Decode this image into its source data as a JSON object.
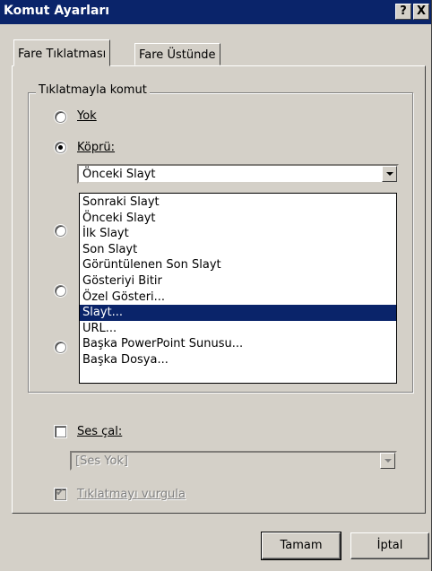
{
  "window": {
    "title": "Komut Ayarları",
    "help_label": "?",
    "close_label": "X"
  },
  "tabs": [
    {
      "label": "Fare Tıklatması",
      "active": true
    },
    {
      "label": "Fare Üstünde",
      "active": false
    }
  ],
  "group": {
    "legend": "Tıklatmayla komut"
  },
  "options": {
    "none_label": "Yok",
    "hyperlink_label": "Köprü:",
    "selected_option": "Köprü:"
  },
  "hyperlink_combo": {
    "value": "Önceki Slayt"
  },
  "dropdown": {
    "items": [
      "Sonraki Slayt",
      "Önceki Slayt",
      "İlk Slayt",
      "Son Slayt",
      "Görüntülenen Son Slayt",
      "Gösteriyi Bitir",
      "Özel Gösteri...",
      "Slayt...",
      "URL...",
      "Başka PowerPoint Sunusu...",
      "Başka Dosya..."
    ],
    "highlighted": "Slayt..."
  },
  "sound": {
    "label": "Ses çal:",
    "checked": false,
    "combo_value": "[Ses Yok]"
  },
  "highlight_click": {
    "label": "Tıklatmayı vurgula",
    "checked": true
  },
  "buttons": {
    "ok": "Tamam",
    "cancel": "İptal"
  }
}
